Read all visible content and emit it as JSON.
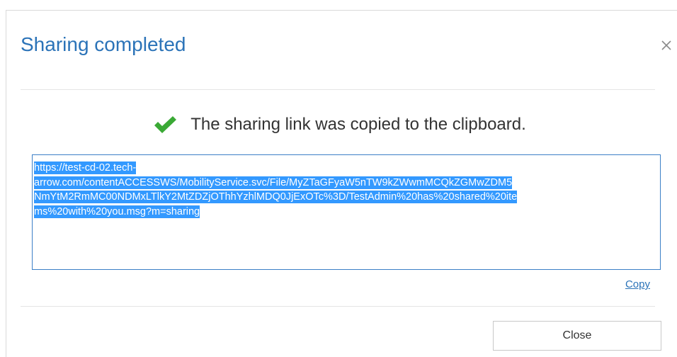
{
  "dialog": {
    "title": "Sharing completed",
    "close_icon": "close-icon",
    "message": "The sharing link was copied to the clipboard.",
    "status_icon": "checkmark-icon",
    "status_color": "#3aa935",
    "link": {
      "lines": [
        "https://test-cd-02.tech-",
        "arrow.com/contentACCESSWS/MobilityService.svc/File/MyZTaGFyaW5nTW9kZWwmMCQkZGMwZDM5",
        "NmYtM2RmMC00NDMxLTlkY2MtZDZjOThhYzhlMDQ0JjExOTc%3D/TestAdmin%20has%20shared%20ite",
        "ms%20with%20you.msg?m=sharing"
      ]
    },
    "copy_label": "Copy",
    "close_button_label": "Close",
    "accent_color": "#2b73b8",
    "selection_color": "#3399ff"
  }
}
